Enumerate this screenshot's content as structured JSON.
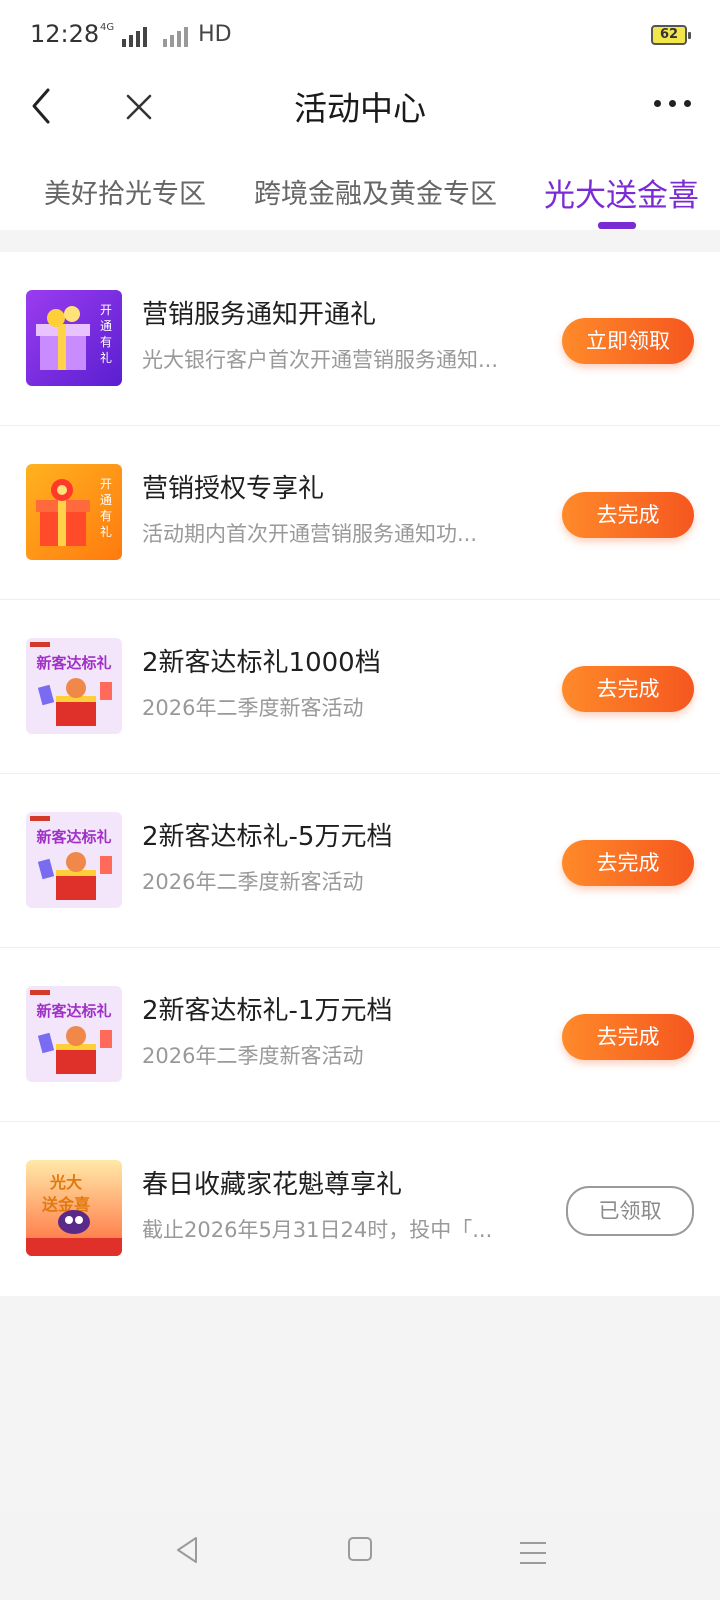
{
  "status_bar": {
    "time": "12:28",
    "network": "4G",
    "hd_label": "HD",
    "battery": "62"
  },
  "header": {
    "title": "活动中心",
    "back_icon": "chevron-left-icon",
    "close_icon": "close-icon",
    "more_icon": "more-dots-icon"
  },
  "tabs": [
    {
      "label": "美好拾光专区",
      "active": false
    },
    {
      "label": "跨境金融及黄金专区",
      "active": false
    },
    {
      "label": "光大送金喜",
      "active": true
    }
  ],
  "accent_color": "#7b2bd3",
  "button_color": "#f5571f",
  "activities": [
    {
      "title": "营销服务通知开通礼",
      "desc": "光大银行客户首次开通营销服务通知...",
      "button": "立即领取",
      "status": "active",
      "thumb_text": "开通有礼"
    },
    {
      "title": "营销授权专享礼",
      "desc": "活动期内首次开通营销服务通知功...",
      "button": "去完成",
      "status": "active",
      "thumb_text": "开通有礼"
    },
    {
      "title": "2新客达标礼1000档",
      "desc": "2026年二季度新客活动",
      "button": "去完成",
      "status": "active",
      "thumb_text": "新客达标礼"
    },
    {
      "title": "2新客达标礼-5万元档",
      "desc": "2026年二季度新客活动",
      "button": "去完成",
      "status": "active",
      "thumb_text": "新客达标礼"
    },
    {
      "title": "2新客达标礼-1万元档",
      "desc": "2026年二季度新客活动",
      "button": "去完成",
      "status": "active",
      "thumb_text": "新客达标礼"
    },
    {
      "title": "春日收藏家花魁尊享礼",
      "desc": "截止2026年5月31日24时，投中「...",
      "button": "已领取",
      "status": "done",
      "thumb_text": "光大送金喜"
    }
  ],
  "system_nav": {
    "back_icon": "nav-back-icon",
    "home_icon": "nav-home-icon",
    "menu_icon": "nav-menu-icon"
  }
}
